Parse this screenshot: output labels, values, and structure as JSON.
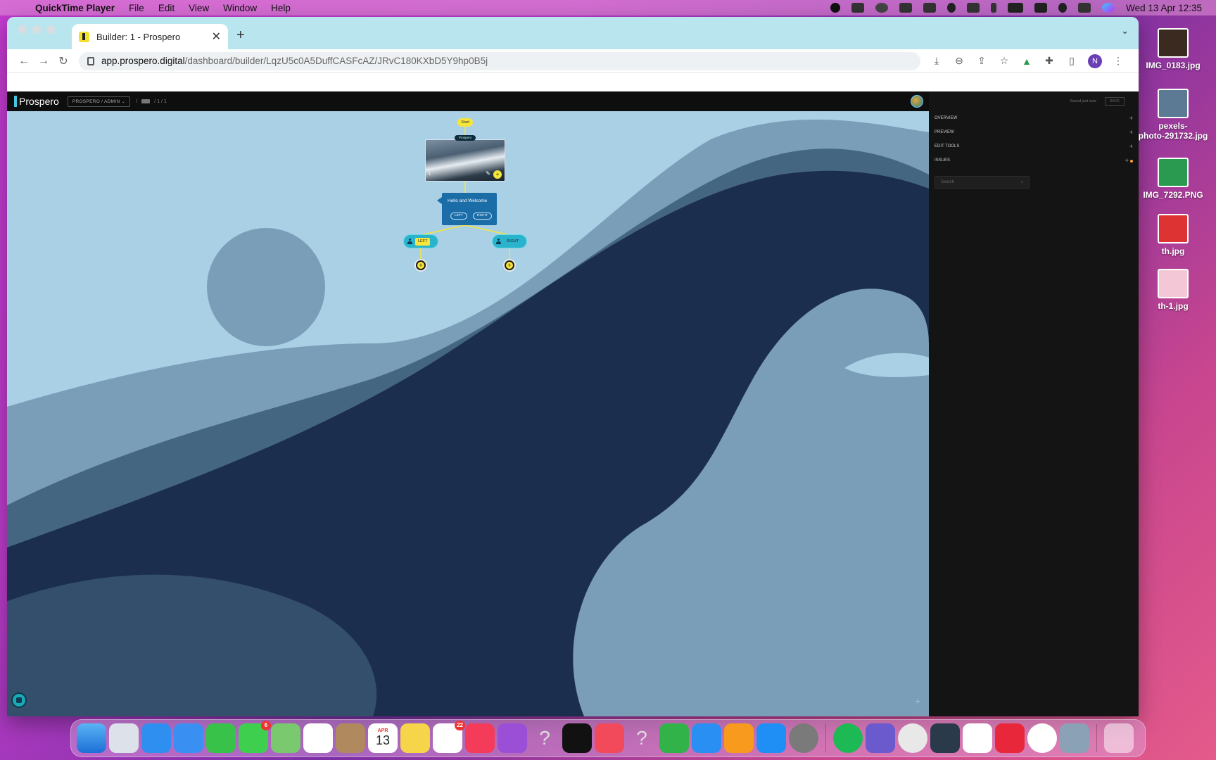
{
  "menubar": {
    "app_name": "QuickTime Player",
    "menus": [
      "File",
      "Edit",
      "View",
      "Window",
      "Help"
    ],
    "clock": "Wed 13 Apr  12:35"
  },
  "browser": {
    "tab_title": "Builder: 1 - Prospero",
    "url_host": "app.prospero.digital",
    "url_path": "/dashboard/builder/LqzU5c0A5DuffCASFcAZ/JRvC180KXbD5Y9hp0B5j",
    "profile_initial": "N"
  },
  "app": {
    "logo": "Prospero",
    "org_selector": "PROSPERO  /  ADMIN  ⌄",
    "breadcrumb_sep": "/",
    "breadcrumb_tail": "/ 1 / 1",
    "panel_status": "Saved just now",
    "panel_button": "SAVE",
    "panel_sections": [
      {
        "label": "OVERVIEW"
      },
      {
        "label": "PREVIEW"
      },
      {
        "label": "EDIT TOOLS"
      },
      {
        "label": "ISSUES"
      }
    ],
    "search_placeholder": "Search"
  },
  "flow": {
    "start_label": "Start",
    "image_node_tag": "Prospero",
    "image_node_number": "1",
    "text_node_title": "Hello and Welcome",
    "choice_left": "LEFT",
    "choice_right": "RIGHT",
    "branch_left_label": "LEFT",
    "branch_right_label": "RIGHT",
    "branch_left_color": "#f6e53a",
    "branch_right_color": "#2ab3cc"
  },
  "desktop_icons": [
    {
      "label": "IMG_0183.jpg",
      "thumb": "#3a2a20"
    },
    {
      "label": "pexels-\nphoto-291732.jpg",
      "thumb": "#5c7a94"
    },
    {
      "label": "IMG_7292.PNG",
      "thumb": "#2a9a50"
    },
    {
      "label": "th.jpg",
      "thumb": "#d33"
    },
    {
      "label": "th-1.jpg",
      "thumb": "#f4c7d6"
    }
  ],
  "dock": {
    "calendar_month": "APR",
    "calendar_day": "13",
    "messages_badge": "6",
    "reminders_badge": "22"
  }
}
